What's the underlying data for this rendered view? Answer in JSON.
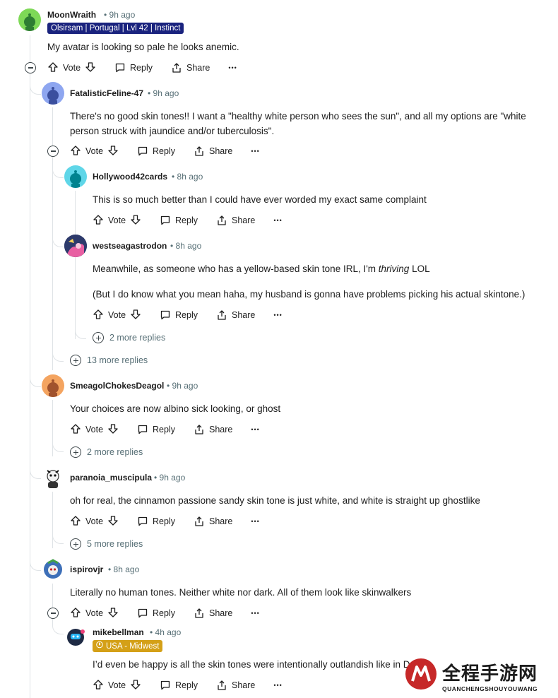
{
  "comments": [
    {
      "username": "MoonWraith",
      "time": "9h ago",
      "flair": "Olsirsam | Portugal | Lvl 42 | Instinct",
      "body": [
        "My avatar is looking so pale he looks anemic."
      ],
      "avatar_color": "#7ed957"
    },
    {
      "username": "FatalisticFeline-47",
      "time": "9h ago",
      "body": [
        "There's no good skin tones!! I want a \"healthy white person who sees the sun\", and all my options are \"white person struck with jaundice and/or tuberculosis\"."
      ],
      "avatar_color": "#8ea6f0"
    },
    {
      "username": "Hollywood42cards",
      "time": "8h ago",
      "body": [
        "This is so much better than I could have ever worded my exact same complaint"
      ],
      "avatar_color": "#5fd6e8"
    },
    {
      "username": "westseagastrodon",
      "time": "8h ago",
      "body_prefix": "Meanwhile, as someone who has a yellow-based skin tone IRL, I'm ",
      "body_em": "thriving",
      "body_suffix": " LOL",
      "body2": "(But I do know what you mean haha, my husband is gonna have problems picking his actual skintone.)"
    },
    {
      "username": "SmeagolChokesDeagol",
      "time": "9h ago",
      "body": [
        "Your choices are now albino sick looking, or ghost"
      ],
      "avatar_color": "#f4a460"
    },
    {
      "username": "paranoia_muscipula",
      "time": "9h ago",
      "body": [
        "oh for real, the cinnamon passione sandy skin tone is just white, and white is straight up ghostlike"
      ]
    },
    {
      "username": "ispirovjr",
      "time": "8h ago",
      "body": [
        "Literally no human tones. Neither white nor dark. All of them look like skinwalkers"
      ]
    },
    {
      "username": "mikebellman",
      "time": "4h ago",
      "flair": "USA - Midwest",
      "body": [
        "I’d even be happy is all the skin tones were intentionally outlandish like in Doug"
      ]
    }
  ],
  "actions": {
    "vote": "Vote",
    "reply": "Reply",
    "share": "Share",
    "overflow": "•••"
  },
  "more_replies": {
    "westseagastrodon": "2 more replies",
    "fatalistic": "13 more replies",
    "smeagol": "2 more replies",
    "paranoia": "5 more replies"
  },
  "watermark": {
    "text_cn": "全程手游网",
    "text_en": "QUANCHENGSHOUYOUWANG"
  },
  "colors": {
    "thread_line": "#dfe3e6",
    "meta_grey": "#576f76",
    "flair_blue": "#1a237e",
    "flair_gold": "#d4a017"
  }
}
